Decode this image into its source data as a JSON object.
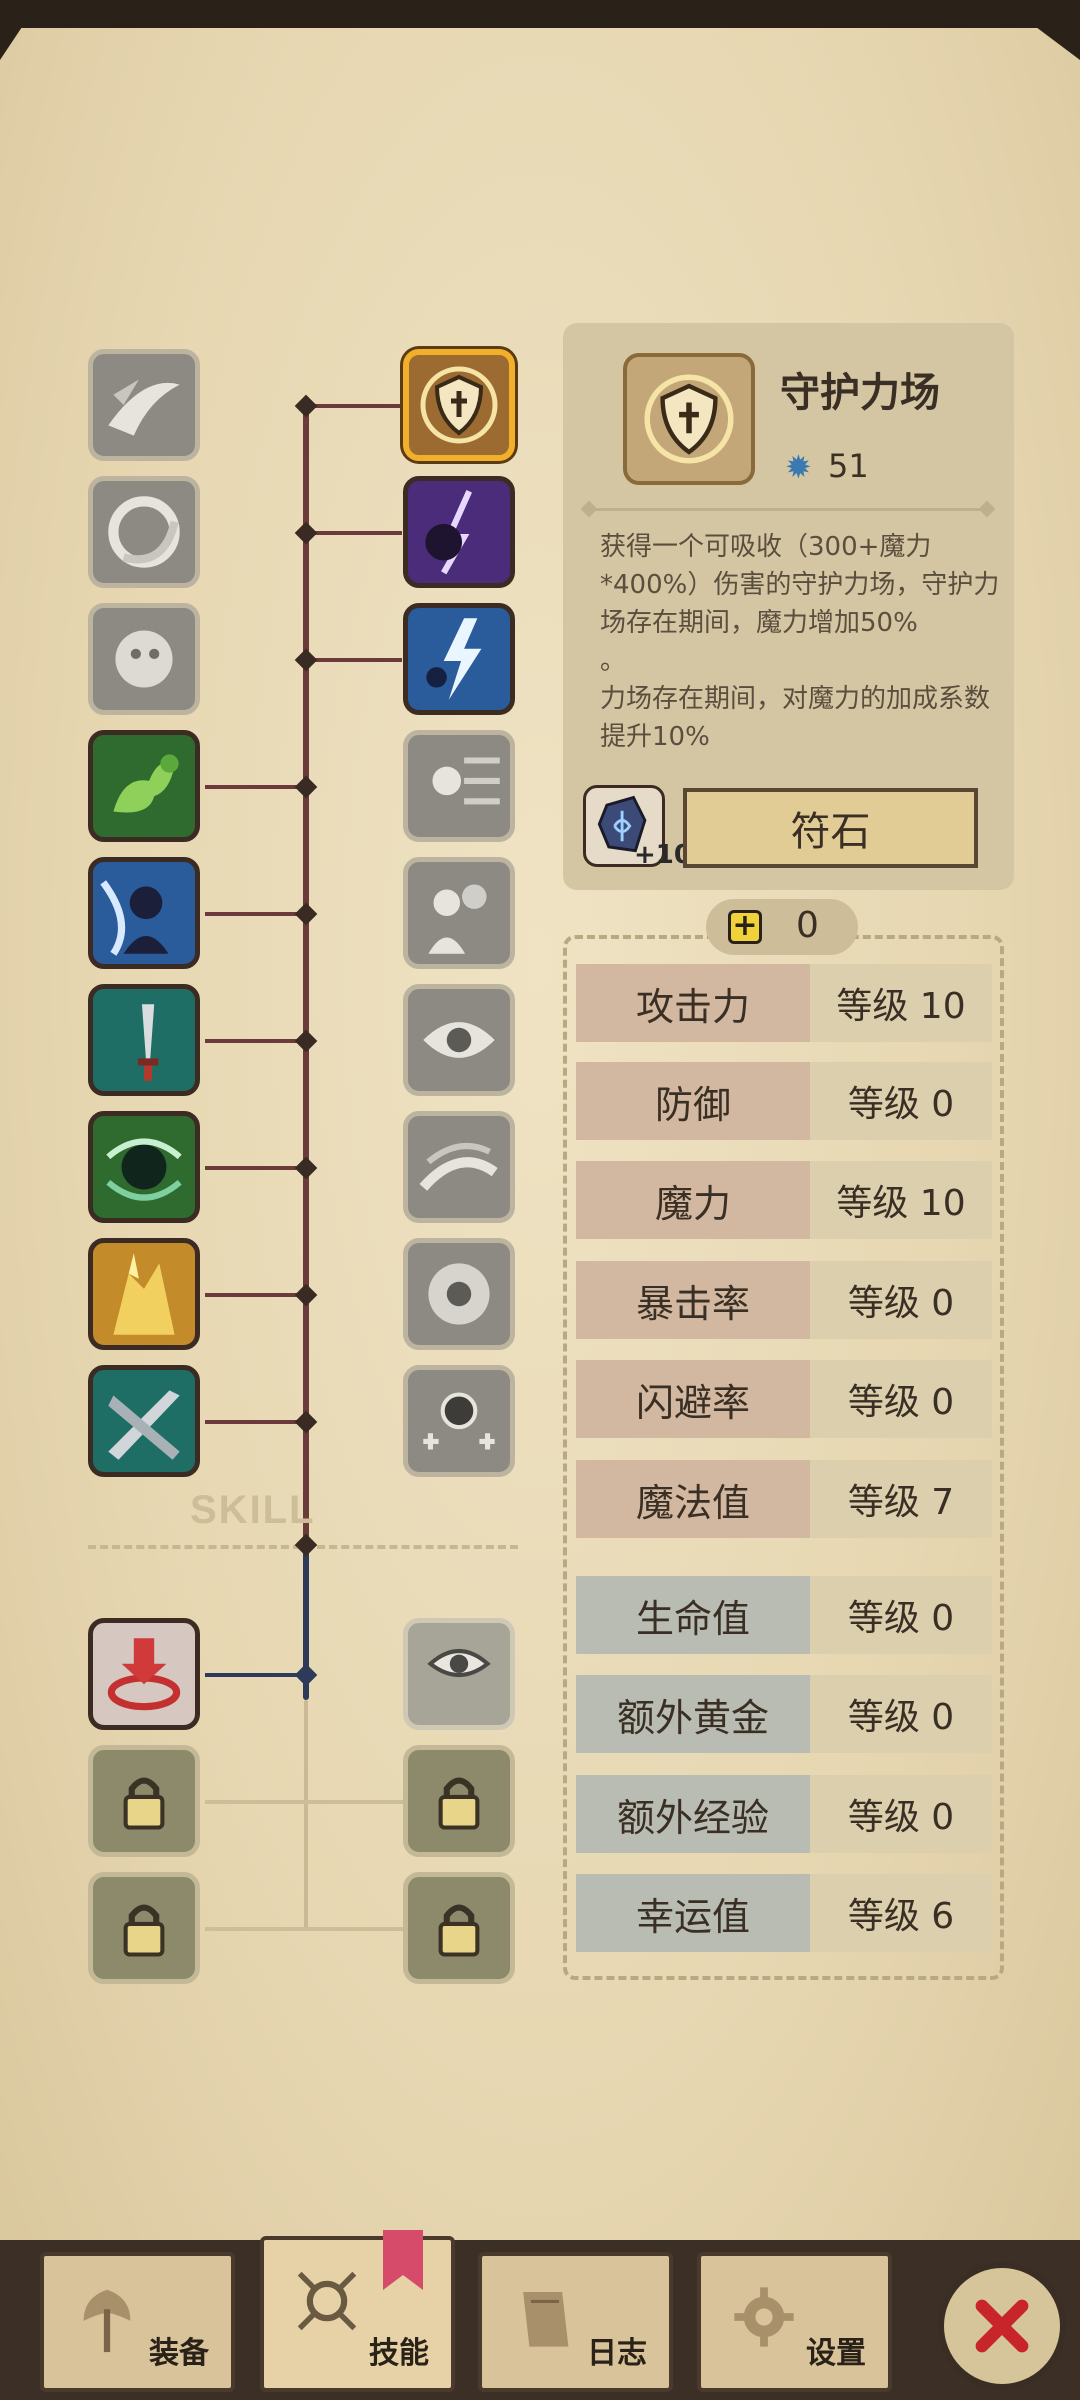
{
  "skill_tree": {
    "watermark": "SKILL"
  },
  "selected_skill": {
    "name": "守护力场",
    "cost": "51",
    "description": "获得一个可吸收（300+魔力*400%）伤害的守护力场，守护力场存在期间，魔力增加50%\n。\n力场存在期间，对魔力的加成系数提升10%",
    "rune_plus": "+10",
    "rune_button_label": "符石"
  },
  "attribute_points": {
    "value": "0"
  },
  "stats": [
    {
      "name": "攻击力",
      "level": "等级 10"
    },
    {
      "name": "防御",
      "level": "等级 0"
    },
    {
      "name": "魔力",
      "level": "等级 10"
    },
    {
      "name": "暴击率",
      "level": "等级 0"
    },
    {
      "name": "闪避率",
      "level": "等级 0"
    },
    {
      "name": "魔法值",
      "level": "等级 7"
    },
    {
      "name": "生命值",
      "level": "等级 0"
    },
    {
      "name": "额外黄金",
      "level": "等级 0"
    },
    {
      "name": "额外经验",
      "level": "等级 0"
    },
    {
      "name": "幸运值",
      "level": "等级 6"
    }
  ],
  "nav": {
    "equipment": "装备",
    "skills": "技能",
    "log": "日志",
    "settings": "设置"
  },
  "colors": {
    "selected_border": "#f2b02a",
    "tree_line": "#6b3a3a",
    "tree_line_bottom": "#2e3a5a",
    "stat_red": "#d2b8a0",
    "stat_blue": "#b9bcb2",
    "close_x": "#c8252a"
  }
}
